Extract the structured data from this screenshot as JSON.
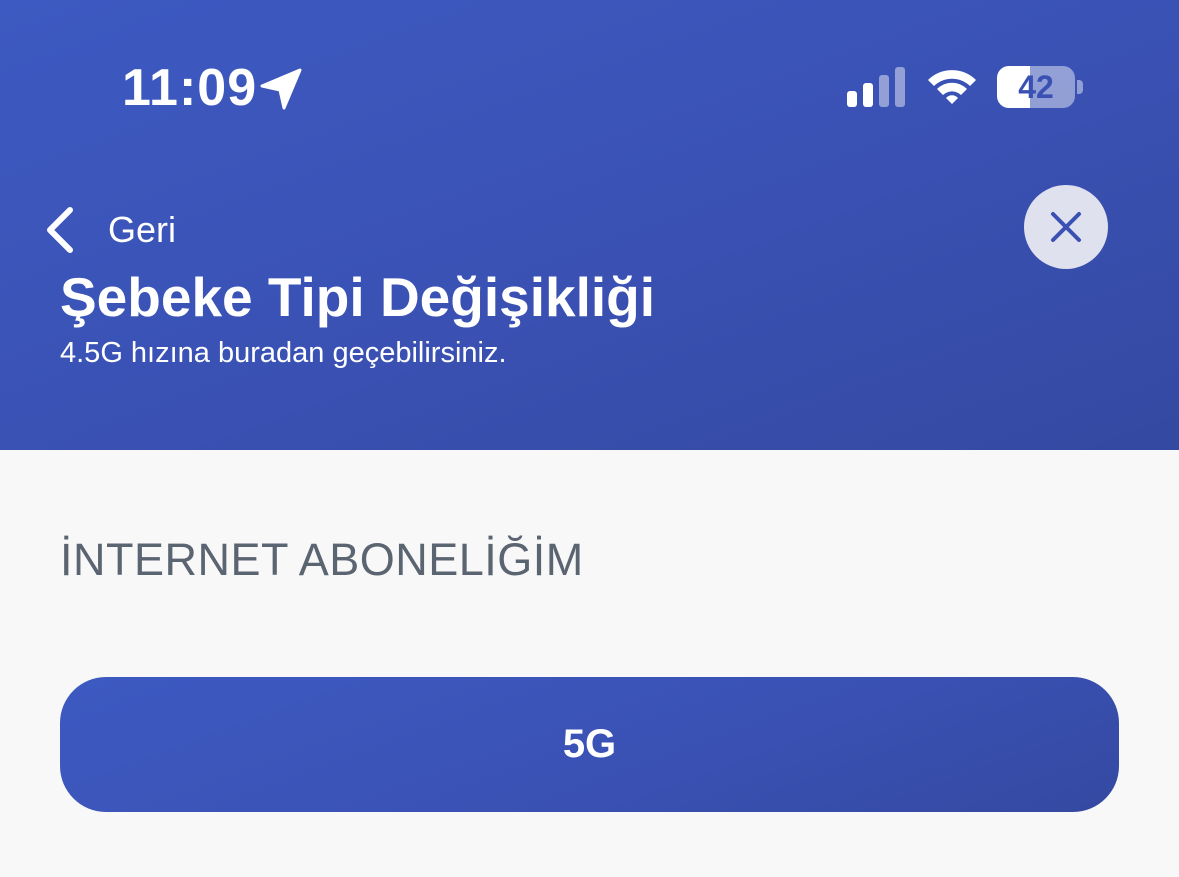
{
  "status_bar": {
    "time": "11:09",
    "battery_level": "42",
    "battery_fraction": 0.42,
    "icons": [
      "location-arrow-icon",
      "cellular-signal-icon",
      "wifi-icon",
      "battery-icon"
    ]
  },
  "header": {
    "back_label": "Geri",
    "title": "Şebeke Tipi Değişikliği",
    "subtitle": "4.5G hızına buradan geçebilirsiniz.",
    "close_icon": "close-icon",
    "back_icon": "chevron-left-icon"
  },
  "main": {
    "section_label": "İNTERNET ABONELİĞİM",
    "option_label": "5G"
  },
  "colors": {
    "brand_blue": "#3a51b3",
    "header_text": "#ffffff",
    "section_label": "#5b6471",
    "background": "#f8f8f8",
    "close_button_bg": "#dfe1ee"
  }
}
